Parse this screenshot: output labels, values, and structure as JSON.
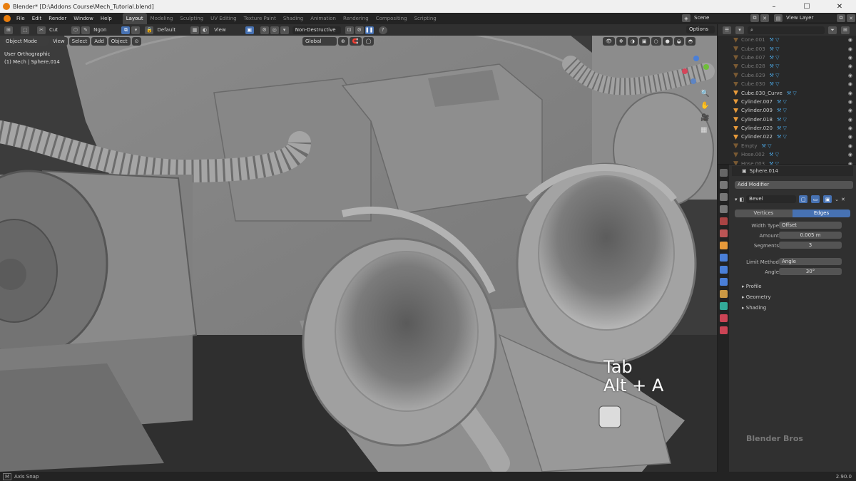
{
  "window": {
    "title": "Blender* [D:\\Addons Course\\Mech_Tutorial.blend]",
    "buttons": [
      "–",
      "☐",
      "✕"
    ]
  },
  "menu": {
    "items": [
      "File",
      "Edit",
      "Render",
      "Window",
      "Help"
    ],
    "workspaces": [
      "Layout",
      "Modeling",
      "Sculpting",
      "UV Editing",
      "Texture Paint",
      "Shading",
      "Animation",
      "Rendering",
      "Compositing",
      "Scripting"
    ],
    "scene_label": "Scene",
    "view_layer_label": "View Layer"
  },
  "toolheader": {
    "tool": "Cut",
    "mode_field": "Ngon",
    "orientation": "Default",
    "view": "View",
    "boolean_mode": "Non-Destructive",
    "options": "Options"
  },
  "viewport_header": {
    "mode": "Object Mode",
    "menus": [
      "View",
      "Select",
      "Add",
      "Object"
    ],
    "transform": "Global"
  },
  "viewport": {
    "view_name": "User Orthographic",
    "collection_info": "(1) Mech | Sphere.014",
    "key_overlay_1": "Tab",
    "key_overlay_2": "Alt + A",
    "watermark": "Blender Bros"
  },
  "outliner": {
    "rows": [
      {
        "name": "Cone.001",
        "dim": true
      },
      {
        "name": "Cube.003",
        "dim": true
      },
      {
        "name": "Cube.007",
        "dim": true
      },
      {
        "name": "Cube.028",
        "dim": true
      },
      {
        "name": "Cube.029",
        "dim": true
      },
      {
        "name": "Cube.030",
        "dim": true
      },
      {
        "name": "Cube.030_Curve",
        "dim": false
      },
      {
        "name": "Cylinder.007",
        "dim": false
      },
      {
        "name": "Cylinder.009",
        "dim": false
      },
      {
        "name": "Cylinder.018",
        "dim": false
      },
      {
        "name": "Cylinder.020",
        "dim": false
      },
      {
        "name": "Cylinder.022",
        "dim": false
      },
      {
        "name": "Empty",
        "dim": true
      },
      {
        "name": "Hose.002",
        "dim": true
      },
      {
        "name": "Hose.003",
        "dim": true
      }
    ]
  },
  "properties": {
    "object_name": "Sphere.014",
    "add_modifier": "Add Modifier",
    "modifier_name": "Bevel",
    "tabs": [
      "Vertices",
      "Edges"
    ],
    "width_type_label": "Width Type",
    "width_type_value": "Offset",
    "amount_label": "Amount",
    "amount_value": "0.005 m",
    "segments_label": "Segments",
    "segments_value": "3",
    "limit_method_label": "Limit Method",
    "limit_method_value": "Angle",
    "angle_label": "Angle",
    "angle_value": "30°",
    "sections": [
      "Profile",
      "Geometry",
      "Shading"
    ]
  },
  "statusbar": {
    "left": "Axis Snap",
    "right": "2.90.0"
  }
}
